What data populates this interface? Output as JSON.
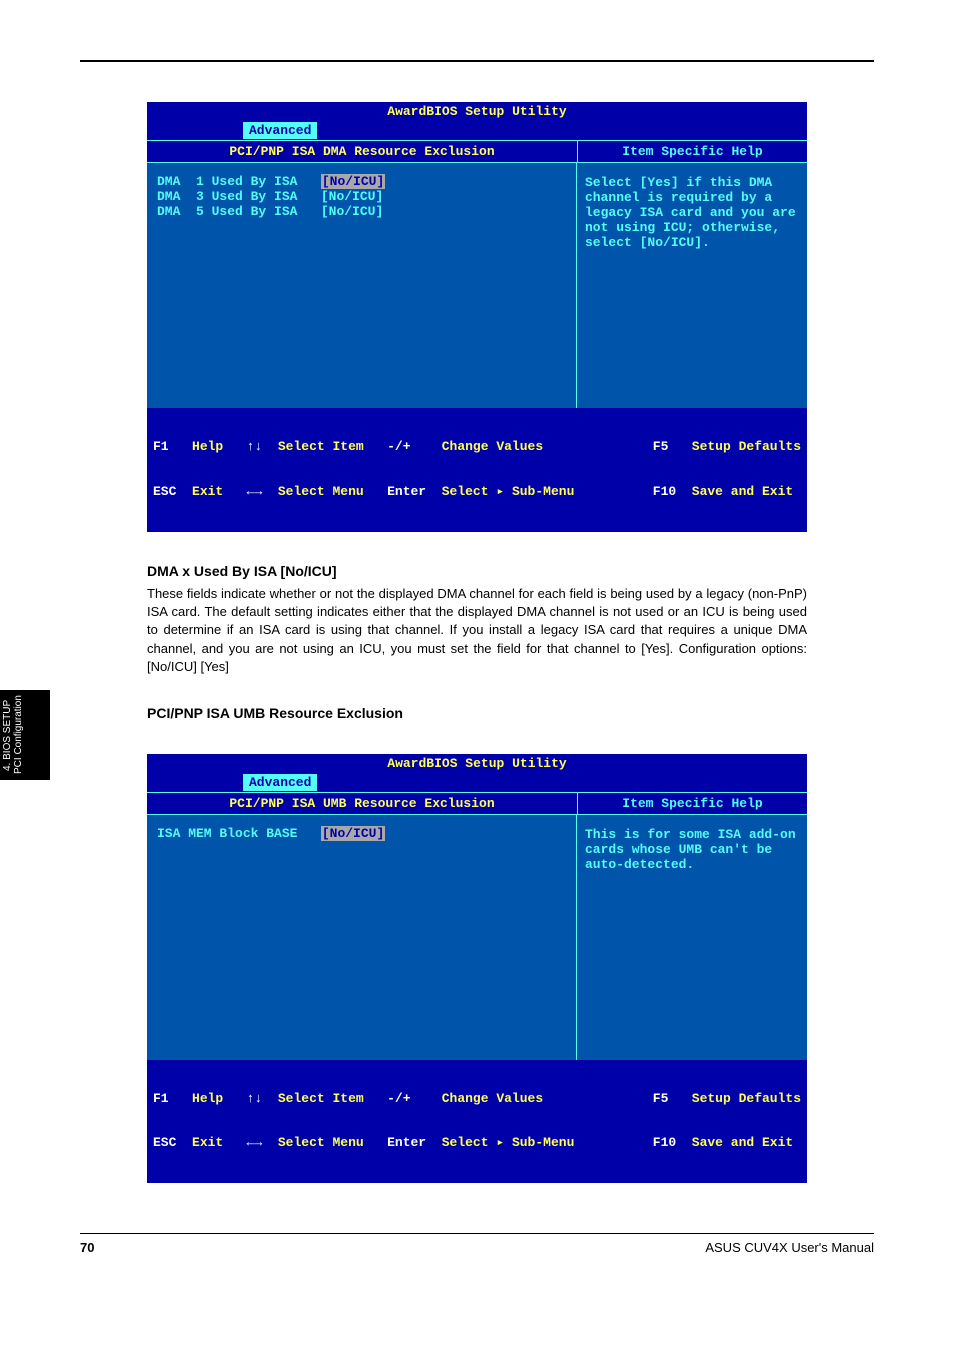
{
  "screen1": {
    "title": "AwardBIOS Setup Utility",
    "active_tab": "Advanced",
    "left_header": "PCI/PNP ISA DMA Resource Exclusion",
    "right_header": "Item Specific Help",
    "rows": [
      {
        "label": "DMA  1 Used By ISA",
        "value": "[No/ICU]",
        "selected": true
      },
      {
        "label": "DMA  3 Used By ISA",
        "value": "[No/ICU]",
        "selected": false
      },
      {
        "label": "DMA  5 Used By ISA",
        "value": "[No/ICU]",
        "selected": false
      }
    ],
    "help_text": "Select [Yes] if this DMA channel is required by a legacy ISA card and you are not using ICU; otherwise, select [No/ICU].",
    "footer": {
      "f1": "F1",
      "help": "Help",
      "arrows_ud": "↑↓",
      "select_item": "Select Item",
      "pm": "-/+",
      "change_values": "Change Values",
      "f5": "F5",
      "setup_defaults": "Setup Defaults",
      "esc": "ESC",
      "exit": "Exit",
      "arrows_lr": "←→",
      "select_menu": "Select Menu",
      "enter": "Enter",
      "sub_menu": "Select ▸ Sub-Menu",
      "f10": "F10",
      "save_exit": "Save and Exit"
    }
  },
  "text1": {
    "heading": "DMA x Used By ISA [No/ICU]",
    "para": "These fields indicate whether or not the displayed DMA channel for each field is being used by a legacy (non-PnP) ISA card. The default setting indicates either that the displayed DMA channel is not used or an ICU is being used to determine if an ISA card is using that channel. If you install a legacy ISA card that requires a unique DMA channel, and you are not using an ICU, you must set the field for that channel to [Yes]. Configuration options: [No/ICU] [Yes]"
  },
  "section_heading": "PCI/PNP ISA UMB Resource Exclusion",
  "screen2": {
    "title": "AwardBIOS Setup Utility",
    "active_tab": "Advanced",
    "left_header": "PCI/PNP ISA UMB Resource Exclusion",
    "right_header": "Item Specific Help",
    "row": {
      "label": "ISA MEM Block BASE",
      "value": "[No/ICU]",
      "selected": true
    },
    "help_text": "This is for some ISA add-on cards whose UMB can't be auto-detected.",
    "footer": {
      "f1": "F1",
      "help": "Help",
      "arrows_ud": "↑↓",
      "select_item": "Select Item",
      "pm": "-/+",
      "change_values": "Change Values",
      "f5": "F5",
      "setup_defaults": "Setup Defaults",
      "esc": "ESC",
      "exit": "Exit",
      "arrows_lr": "←→",
      "select_menu": "Select Menu",
      "enter": "Enter",
      "sub_menu": "Select ▸ Sub-Menu",
      "f10": "F10",
      "save_exit": "Save and Exit"
    }
  },
  "page_footer": {
    "page_num": "70",
    "book": "ASUS CUV4X User's Manual"
  },
  "side_tab_text": "4. BIOS SETUP\nPCI Configuration"
}
